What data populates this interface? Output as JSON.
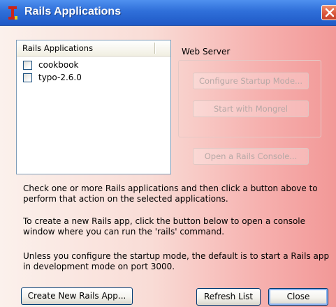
{
  "window": {
    "title": "Rails Applications",
    "accent": "#2f6fd9"
  },
  "list": {
    "header": "Rails Applications",
    "items": [
      {
        "label": "cookbook",
        "checked": false
      },
      {
        "label": "typo-2.6.0",
        "checked": false
      }
    ]
  },
  "web_server": {
    "group_label": "Web Server",
    "configure_label": "Configure Startup Mode...",
    "mongrel_label": "Start with Mongrel",
    "console_label": "Open a Rails Console..."
  },
  "help": {
    "p1": "Check one or more Rails applications and then click a button above to perform that action on the selected applications.",
    "p2": "To create a new Rails app, click the button below to open a console window where you can run the 'rails' command.",
    "p3": "Unless you configure the startup mode, the default is to start a Rails app in development mode on port 3000."
  },
  "buttons": {
    "create_label": "Create New Rails App...",
    "refresh_label": "Refresh List",
    "close_label": "Close"
  }
}
